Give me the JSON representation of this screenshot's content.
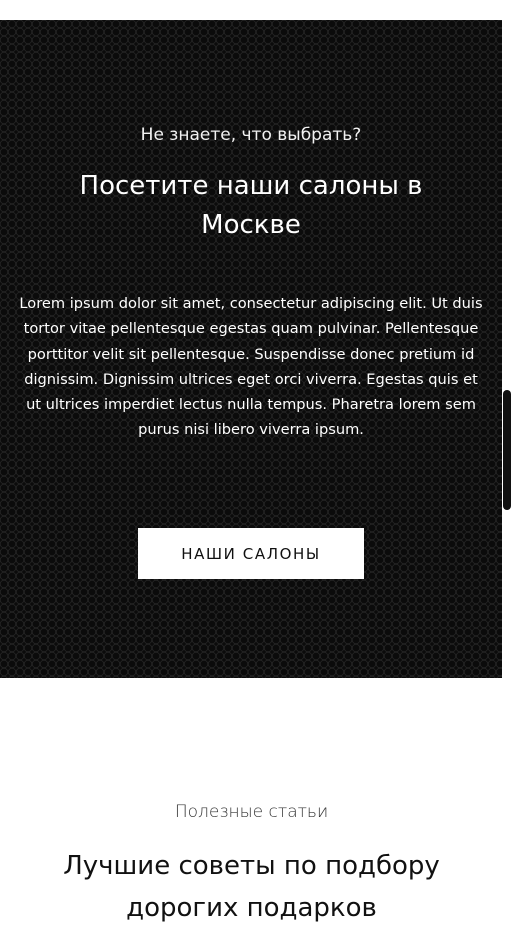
{
  "promo": {
    "eyebrow": "Не знаете, что выбрать?",
    "title": "Посетите наши салоны в Москве",
    "text": "Lorem ipsum dolor sit amet, consectetur adipiscing elit. Ut duis tortor vitae pellentesque egestas quam pulvinar. Pellentesque porttitor velit sit pellentesque. Suspendisse donec pretium id dignissim. Dignissim ultrices eget orci viverra. Egestas quis et ut ultrices imperdiet lectus nulla tempus. Pharetra lorem sem purus nisi libero viverra ipsum.",
    "button_label": "НАШИ САЛОНЫ"
  },
  "articles": {
    "eyebrow": "Полезные статьи",
    "title": "Лучшие советы по подбору дорогих подарков"
  },
  "colors": {
    "promo_background": "#0b0b0b",
    "button_background": "#ffffff",
    "page_background": "#ffffff"
  }
}
